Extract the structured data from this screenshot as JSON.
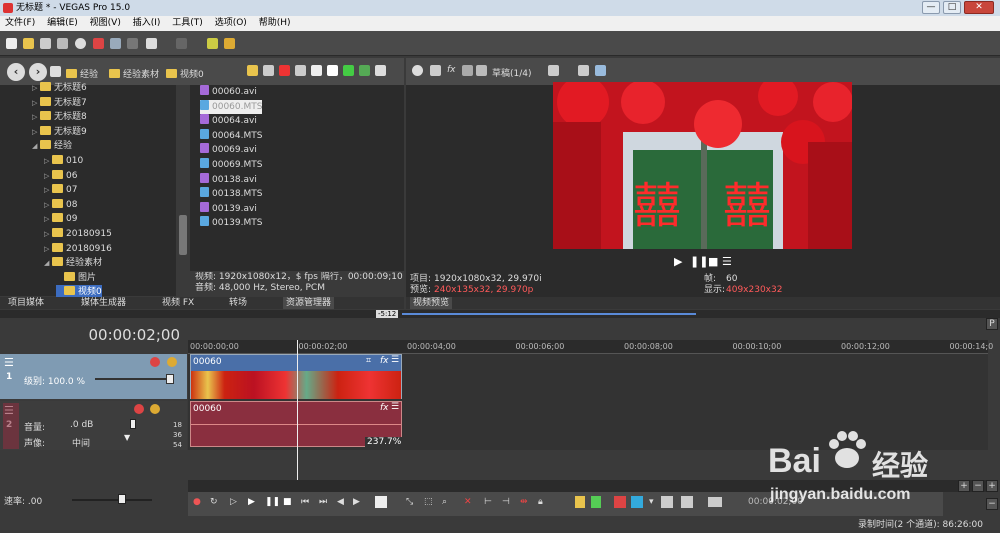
{
  "window": {
    "title": "无标题 * - VEGAS Pro 15.0",
    "min": "—",
    "max": "□",
    "close": "✕"
  },
  "menu": [
    "文件(F)",
    "编辑(E)",
    "视图(V)",
    "插入(I)",
    "工具(T)",
    "选项(O)",
    "帮助(H)"
  ],
  "explorer": {
    "breadcrumb": [
      "经验",
      "经验素材",
      "视频0"
    ],
    "tree": [
      {
        "label": "无标题6",
        "indent": 1
      },
      {
        "label": "无标题7",
        "indent": 1
      },
      {
        "label": "无标题8",
        "indent": 1
      },
      {
        "label": "无标题9",
        "indent": 1
      },
      {
        "label": "经验",
        "indent": 1,
        "expanded": true
      },
      {
        "label": "010",
        "indent": 2
      },
      {
        "label": "06",
        "indent": 2
      },
      {
        "label": "07",
        "indent": 2
      },
      {
        "label": "08",
        "indent": 2
      },
      {
        "label": "09",
        "indent": 2
      },
      {
        "label": "20180915",
        "indent": 2
      },
      {
        "label": "20180916",
        "indent": 2
      },
      {
        "label": "经验素材",
        "indent": 2,
        "expanded": true
      },
      {
        "label": "图片",
        "indent": 3
      },
      {
        "label": "视频0",
        "indent": 3,
        "selected": true
      }
    ],
    "files": [
      {
        "name": "00060.avi",
        "type": "avi"
      },
      {
        "name": "00060.MTS",
        "type": "mts",
        "selected": true
      },
      {
        "name": "00064.avi",
        "type": "avi"
      },
      {
        "name": "00064.MTS",
        "type": "mts"
      },
      {
        "name": "00069.avi",
        "type": "avi"
      },
      {
        "name": "00069.MTS",
        "type": "mts"
      },
      {
        "name": "00138.avi",
        "type": "avi"
      },
      {
        "name": "00138.MTS",
        "type": "mts"
      },
      {
        "name": "00139.avi",
        "type": "avi"
      },
      {
        "name": "00139.MTS",
        "type": "mts"
      }
    ],
    "info_video": "视频: 1920x1080x12，$ fps 隔行，00:00:09;10，AVC",
    "info_audio": "音频: 48,000 Hz, Stereo, PCM"
  },
  "left_tabs": [
    "项目媒体",
    "媒体生成器",
    "视频 FX",
    "转场",
    "资源管理器"
  ],
  "preview": {
    "quality": "草稿(1/4)",
    "project_label": "项目:",
    "project_value": "1920x1080x32, 29.970i",
    "preview_label": "预览:",
    "preview_value": "240x135x32, 29.970p",
    "frame_label": "帧:",
    "frame_value": "60",
    "display_label": "显示:",
    "display_value": "409x230x32",
    "tab": "视频预览"
  },
  "timeline": {
    "timecode": "00:00:02;00",
    "loop_marker": "-5:12",
    "ruler": [
      "00:00:00;00",
      "00:00:02;00",
      "00:00:04;00",
      "00:00:06;00",
      "00:00:08;00",
      "00:00:10;00",
      "00:00:12;00",
      "00:00:14;0"
    ],
    "video_track": {
      "num": "1",
      "level_label": "级别: 100.0 %",
      "clip_name": "00060"
    },
    "audio_track": {
      "num": "2",
      "volume_label": "音量:",
      "volume_value": ".0 dB",
      "pan_label": "声像:",
      "pan_value": "中间",
      "clip_name": "00060",
      "meter_18": "18",
      "meter_36": "36",
      "meter_54": "54",
      "pct": "237.7%"
    },
    "rate_label": "速率: .00",
    "end_time": "00:00:02;00"
  },
  "status": {
    "record_time": "录制时间(2 个通道): 86:26:00"
  },
  "watermark": {
    "brand": "Bai",
    "brand_cn": "经验",
    "url": "jingyan.baidu.com"
  },
  "colors": {
    "accent": "#3c6cc0",
    "video_track": "#7f9bb3",
    "audio_clip": "#8a2f3f",
    "folder": "#e9c44d"
  }
}
